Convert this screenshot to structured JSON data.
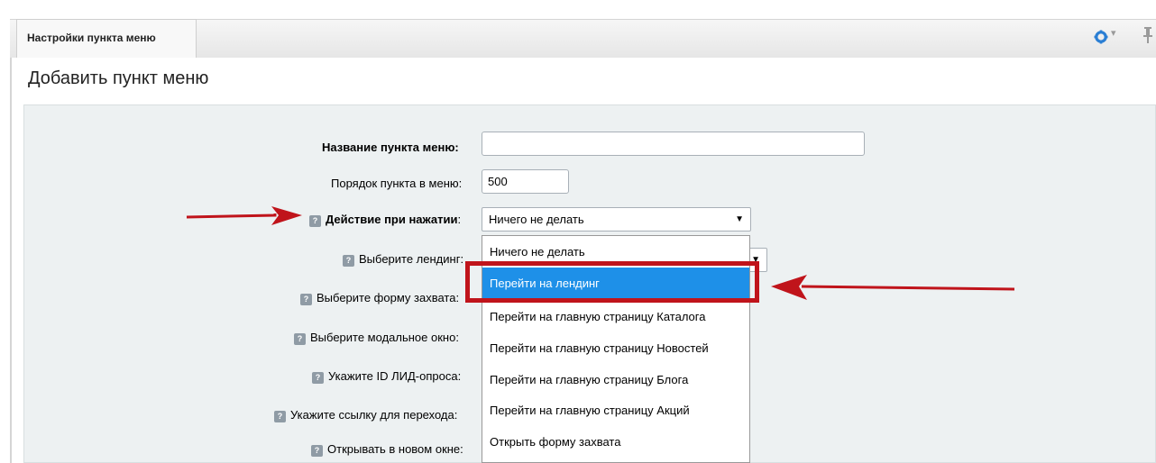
{
  "tab": {
    "label": "Настройки пункта меню"
  },
  "page": {
    "title": "Добавить пункт меню"
  },
  "help_icon": "?",
  "form": {
    "name_label": "Название пункта меню:",
    "name_value": "",
    "order_label": "Порядок пункта в меню:",
    "order_value": "500",
    "action_label": "Действие при нажатии",
    "action_colon": ":",
    "action_value": "Ничего не делать",
    "landing_label": "Выберите лендинг:",
    "capture_form_label": "Выберите форму захвата:",
    "modal_label": "Выберите модальное окно:",
    "poll_label": "Укажите ID ЛИД-опроса:",
    "link_label": "Укажите ссылку для перехода:",
    "new_window_label": "Открывать в новом окне:"
  },
  "dropdown": {
    "options": [
      "Ничего не делать",
      "Перейти на лендинг",
      "Перейти на главную страницу Каталога",
      "Перейти на главную страницу Новостей",
      "Перейти на главную страницу Блога",
      "Перейти на главную страницу Акций",
      "Открыть форму захвата"
    ],
    "highlighted_index": 1
  },
  "colors": {
    "accent": "#1e90e8",
    "annotation": "#c0141b",
    "panel": "#edf1f2"
  },
  "icons": [
    "gear-icon",
    "pin-icon",
    "help-icon",
    "arrow-icon"
  ]
}
